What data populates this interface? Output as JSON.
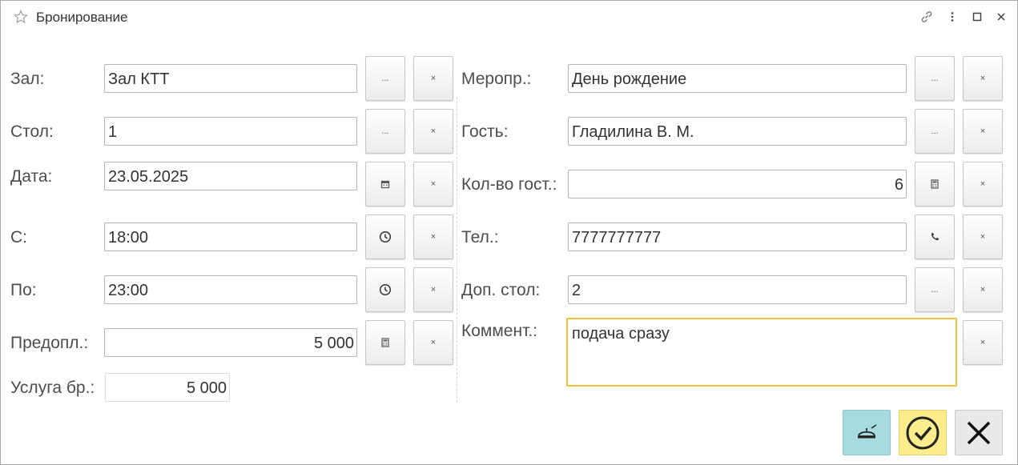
{
  "window": {
    "title": "Бронирование"
  },
  "colors": {
    "focus_border": "#f0c23a",
    "service_button": "#a8dbe0",
    "ok_button": "#fbec8c",
    "cancel_button": "#e9e9e9"
  },
  "icons": {
    "favorite": "star-icon",
    "link": "link-icon",
    "more": "more-icon",
    "maximize": "maximize-icon",
    "close": "close-icon",
    "choose": "ellipsis",
    "clear": "x",
    "calendar": "calendar-icon",
    "clock": "clock-icon",
    "calculator": "calculator-icon",
    "phone": "phone-icon",
    "service": "dish-icon",
    "ok": "check-circle-icon",
    "cancel": "x-icon"
  },
  "buttons": {
    "choose_glyph": "...",
    "clear_glyph": "×"
  },
  "form": {
    "hall": {
      "label": "Зал:",
      "value": "Зал КТТ"
    },
    "table": {
      "label": "Стол:",
      "value": "1"
    },
    "date": {
      "label": "Дата:",
      "value": "23.05.2025"
    },
    "from": {
      "label": "С:",
      "value": "18:00"
    },
    "to": {
      "label": "По:",
      "value": "23:00"
    },
    "prepay": {
      "label": "Предопл.:",
      "value": "5 000"
    },
    "service_fee": {
      "label": "Услуга бр.:",
      "value": "5 000"
    },
    "event": {
      "label": "Меропр.:",
      "value": "День рождение"
    },
    "guest": {
      "label": "Гость:",
      "value": "Гладилина В. М."
    },
    "guest_count": {
      "label": "Кол-во гост.:",
      "value": "6"
    },
    "phone": {
      "label": "Тел.:",
      "value": "7777777777"
    },
    "extra_table": {
      "label": "Доп. стол:",
      "value": "2"
    },
    "comment": {
      "label": "Коммент.:",
      "value": "подача сразу"
    }
  }
}
